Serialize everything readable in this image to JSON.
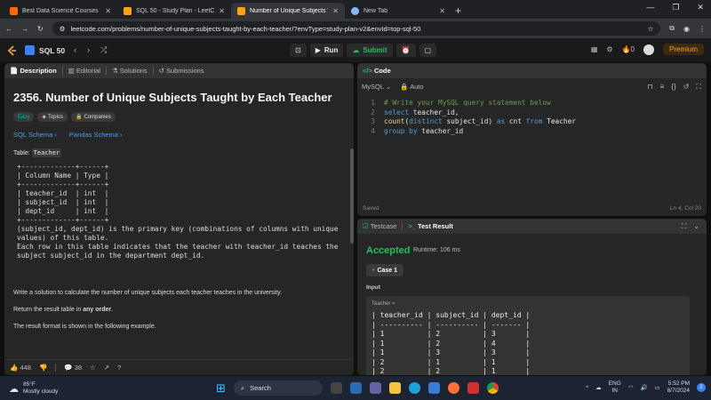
{
  "browser": {
    "tabs": [
      {
        "title": "Best Data Science Courses | Da",
        "favicon_color": "#ff6a00"
      },
      {
        "title": "SQL 50 - Study Plan - LeetCode",
        "favicon_color": "#ffa116"
      },
      {
        "title": "Number of Unique Subjects Ta",
        "favicon_color": "#ffa116",
        "active": true
      },
      {
        "title": "New Tab",
        "favicon_color": "#8ab4f8"
      }
    ],
    "url": "leetcode.com/problems/number-of-unique-subjects-taught-by-each-teacher/?envType=study-plan-v2&envId=top-sql-50"
  },
  "nav": {
    "study_plan": "SQL 50",
    "run": "Run",
    "submit": "Submit",
    "streak": "0",
    "premium": "Premium"
  },
  "left_tabs": [
    "Description",
    "Editorial",
    "Solutions",
    "Submissions"
  ],
  "problem": {
    "title": "2356. Number of Unique Subjects Taught by Each Teacher",
    "difficulty": "Easy",
    "topics": "Topics",
    "companies": "Companies",
    "sql_schema": "SQL Schema",
    "pandas_schema": "Pandas Schema",
    "table_label": "Table:",
    "table_name": "Teacher",
    "schema_text": "+-------------+------+\n| Column Name | Type |\n+-------------+------+\n| teacher_id  | int  |\n| subject_id  | int  |\n| dept_id     | int  |\n+-------------+------+\n(subject_id, dept_id) is the primary key (combinations of columns with unique\nvalues) of this table.\nEach row in this table indicates that the teacher with teacher_id teaches the\nsubject subject_id in the department dept_id.",
    "para1": "Write a solution to calculate the number of unique subjects each teacher teaches in the university.",
    "para2_pre": "Return the result table in ",
    "para2_bold": "any order",
    "para2_post": ".",
    "para3": "The result format is shown in the following example.",
    "likes": "448",
    "comments": "38"
  },
  "editor": {
    "title": "Code",
    "language": "MySQL",
    "mode": "Auto",
    "line_numbers": [
      "1",
      "2",
      "3",
      "4"
    ],
    "saved": "Saved",
    "cursor": "Ln 4, Col 20"
  },
  "result": {
    "tab_testcase": "Testcase",
    "tab_result": "Test Result",
    "status": "Accepted",
    "runtime": "Runtime: 106 ms",
    "case": "Case 1",
    "input_label": "Input",
    "table_caption": "Teacher =",
    "table_text": "| teacher_id | subject_id | dept_id |\n| ---------- | ---------- | ------- |\n| 1          | 2          | 3       |\n| 1          | 2          | 4       |\n| 1          | 3          | 3       |\n| 2          | 1          | 1       |\n| 2          | 2          | 1       |"
  },
  "taskbar": {
    "temp": "85°F",
    "weather": "Mostly cloudy",
    "search": "Search",
    "lang1": "ENG",
    "lang2": "IN",
    "time": "5:52 PM",
    "date": "8/7/2024",
    "badge": "2"
  }
}
